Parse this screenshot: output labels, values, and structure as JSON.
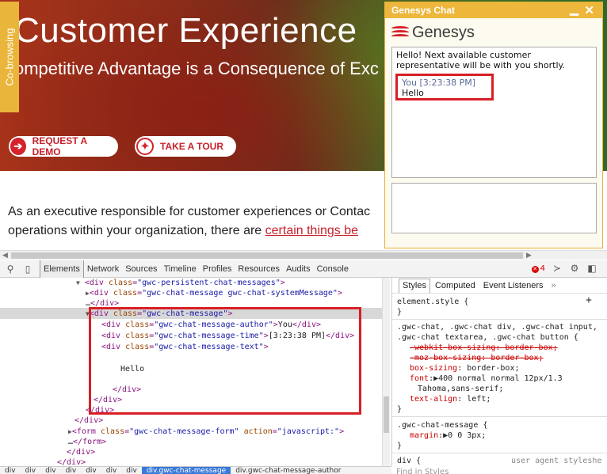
{
  "site": {
    "cobrowse_label": "Co-browsing",
    "hero_title": "Customer Experience",
    "hero_subtitle": "ompetitive Advantage is a Consequence of Exc",
    "cta_demo": "REQUEST A DEMO",
    "cta_tour": "TAKE A TOUR",
    "body_line1": "As an executive responsible for customer experiences or Contac",
    "body_line2_prefix": "operations within your organization, there are ",
    "body_line2_link": "certain things be"
  },
  "chat": {
    "title": "Genesys Chat",
    "brand": "Genesys",
    "system_message": "Hello! Next available customer representative will be with you shortly.",
    "message_author": "You",
    "message_time": "[3:23:38 PM]",
    "message_text": "Hello"
  },
  "devtools": {
    "tabs": [
      "Elements",
      "Network",
      "Sources",
      "Timeline",
      "Profiles",
      "Resources",
      "Audits",
      "Console"
    ],
    "error_count": "4",
    "dom": {
      "l1_tag": "div",
      "l1_attr": "class",
      "l1_val": "\"gwc-persistent-chat-messages\"",
      "l2_tag": "div",
      "l2_attr": "class",
      "l2_val": "\"gwc-chat-message gwc-chat-systemMessage\"",
      "l3_close": "</div>",
      "l4_tag": "div",
      "l4_attr": "class",
      "l4_val": "\"gwc-chat-message\"",
      "l5_val": "\"gwc-chat-message-author\"",
      "l5_text": "You",
      "l6_val": "\"gwc-chat-message-time\"",
      "l6_text": "[3:23:38 PM]",
      "l7_val": "\"gwc-chat-message-text\"",
      "l8_text": "Hello",
      "l9_close": "</div>",
      "l10_close": "</div>",
      "l11_close": "</div>",
      "l12_close": "</div>",
      "l13_tag": "form",
      "l13_attr1": "class",
      "l13_val1": "\"gwc-chat-message-form\"",
      "l13_attr2": "action",
      "l13_val2": "\"javascript:\"",
      "l14_close": "</form>",
      "l15_close": "</div>",
      "l16_close": "</div>"
    },
    "styles": {
      "tabs": [
        "Styles",
        "Computed",
        "Event Listeners"
      ],
      "element_style": "element.style {",
      "close_brace": "}",
      "rule1_selector_a": ".gwc-chat, .gwc-chat div, .gwc-chat input,",
      "rule1_selector_b": ".gwc-chat textarea, .gwc-chat button {",
      "rule1_p1": "-webkit-box-sizing: border-box;",
      "rule1_p2": "-moz-box-sizing: border-box;",
      "rule1_p3_name": "box-sizing",
      "rule1_p3_val": ": border-box;",
      "rule1_p4_name": "font",
      "rule1_p4_val": ":▶400 normal normal 12px/1.3",
      "rule1_p4_cont": "Tahoma,sans-serif;",
      "rule1_p5_name": "text-align",
      "rule1_p5_val": ": left;",
      "rule2_selector": ".gwc-chat-message {",
      "rule2_p1_name": "margin",
      "rule2_p1_val": ":▶0 0 3px;",
      "rule3_selector": "div {",
      "rule3_source": "user agent styleshe",
      "find_placeholder": "Find in Styles"
    },
    "breadcrumbs": [
      "div",
      "div",
      "div",
      "div",
      "div",
      "div",
      "div",
      "div.gwc-chat-message",
      "div.gwc-chat-message-author"
    ]
  },
  "colors": {
    "accent_chat": "#edb73c",
    "highlight_red": "#d81f26",
    "link_red": "#c8202a",
    "breadcrumb_active": "#3879d9"
  }
}
